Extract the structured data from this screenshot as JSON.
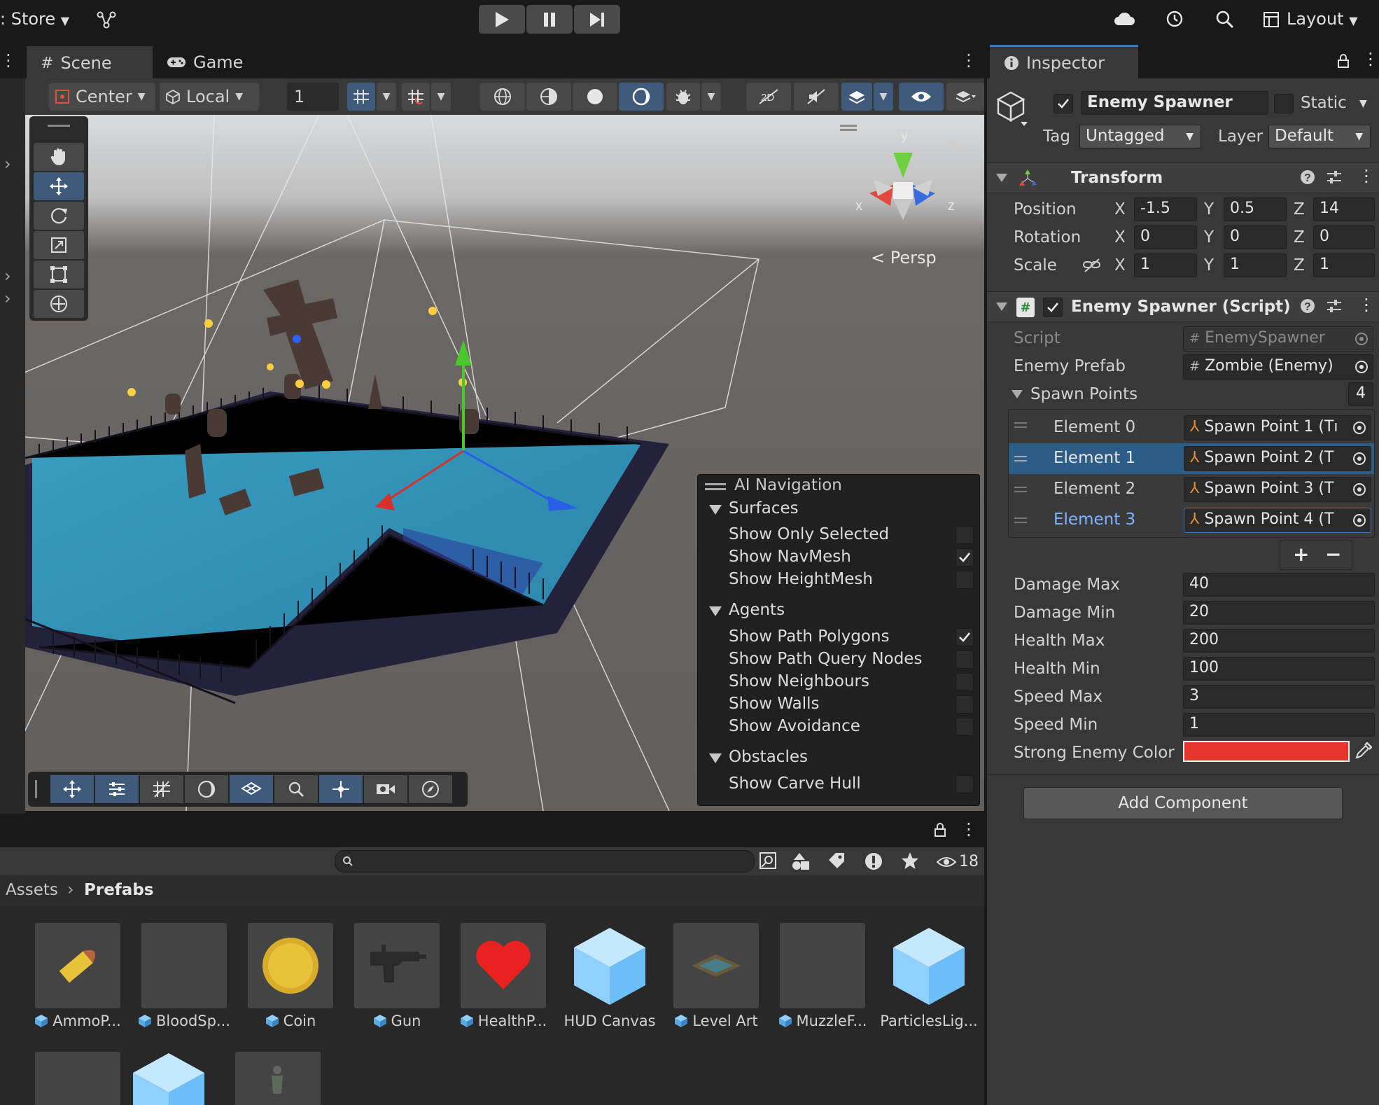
{
  "topbar": {
    "store_label": ": Store",
    "layout_label": "Layout"
  },
  "scene_tabs": {
    "scene": "Scene",
    "game": "Game"
  },
  "scene_toolbar": {
    "pivot": "Center",
    "space": "Local",
    "grid_size": "1"
  },
  "viewport": {
    "persp_label": "< Persp",
    "gizmo_axes": {
      "x": "x",
      "y": "y",
      "z": "z"
    }
  },
  "ai_navigation": {
    "title": "AI Navigation",
    "groups": [
      {
        "name": "Surfaces",
        "items": [
          {
            "label": "Show Only Selected",
            "checked": false
          },
          {
            "label": "Show NavMesh",
            "checked": true
          },
          {
            "label": "Show HeightMesh",
            "checked": false
          }
        ]
      },
      {
        "name": "Agents",
        "items": [
          {
            "label": "Show Path Polygons",
            "checked": true
          },
          {
            "label": "Show Path Query Nodes",
            "checked": false
          },
          {
            "label": "Show Neighbours",
            "checked": false
          },
          {
            "label": "Show Walls",
            "checked": false
          },
          {
            "label": "Show Avoidance",
            "checked": false
          }
        ]
      },
      {
        "name": "Obstacles",
        "items": [
          {
            "label": "Show Carve Hull",
            "checked": false
          }
        ]
      }
    ]
  },
  "project": {
    "visible_count": "18",
    "breadcrumb": [
      "Assets",
      "Prefabs"
    ],
    "assets": [
      {
        "name": "AmmoP...",
        "thumb": "bullet"
      },
      {
        "name": "BloodSp...",
        "thumb": "empty"
      },
      {
        "name": "Coin",
        "thumb": "coin"
      },
      {
        "name": "Gun",
        "thumb": "gun"
      },
      {
        "name": "HealthP...",
        "thumb": "heart"
      },
      {
        "name": "HUD Canvas",
        "thumb": "cube"
      },
      {
        "name": "Level Art",
        "thumb": "level"
      },
      {
        "name": "MuzzleF...",
        "thumb": "empty"
      },
      {
        "name": "ParticlesLig...",
        "thumb": "cube"
      }
    ]
  },
  "inspector": {
    "tab": "Inspector",
    "object_name": "Enemy Spawner",
    "static_label": "Static",
    "tag_label": "Tag",
    "tag_value": "Untagged",
    "layer_label": "Layer",
    "layer_value": "Default",
    "transform": {
      "title": "Transform",
      "rows": [
        {
          "label": "Position",
          "x": "-1.5",
          "y": "0.5",
          "z": "14"
        },
        {
          "label": "Rotation",
          "x": "0",
          "y": "0",
          "z": "0"
        },
        {
          "label": "Scale",
          "x": "1",
          "y": "1",
          "z": "1"
        }
      ],
      "axis_x": "X",
      "axis_y": "Y",
      "axis_z": "Z"
    },
    "script_component": {
      "title": "Enemy Spawner (Script)",
      "script_label": "Script",
      "script_value": "EnemySpawner",
      "prefab_label": "Enemy Prefab",
      "prefab_value": "Zombie (Enemy)",
      "spawn_points_label": "Spawn Points",
      "spawn_points_count": "4",
      "elements": [
        {
          "label": "Element 0",
          "value": "Spawn Point 1 (Tı"
        },
        {
          "label": "Element 1",
          "value": "Spawn Point 2 (T"
        },
        {
          "label": "Element 2",
          "value": "Spawn Point 3 (T"
        },
        {
          "label": "Element 3",
          "value": "Spawn Point 4 (T"
        }
      ],
      "fields": [
        {
          "label": "Damage Max",
          "value": "40"
        },
        {
          "label": "Damage Min",
          "value": "20"
        },
        {
          "label": "Health Max",
          "value": "200"
        },
        {
          "label": "Health Min",
          "value": "100"
        },
        {
          "label": "Speed Max",
          "value": "3"
        },
        {
          "label": "Speed Min",
          "value": "1"
        }
      ],
      "color_label": "Strong Enemy Color",
      "color_value": "#e8352b"
    },
    "add_component": "Add Component"
  },
  "colors": {
    "selection_blue": "#2c5d87",
    "accent_blue": "#3f5a7a",
    "link_blue": "#7fb4ff"
  }
}
